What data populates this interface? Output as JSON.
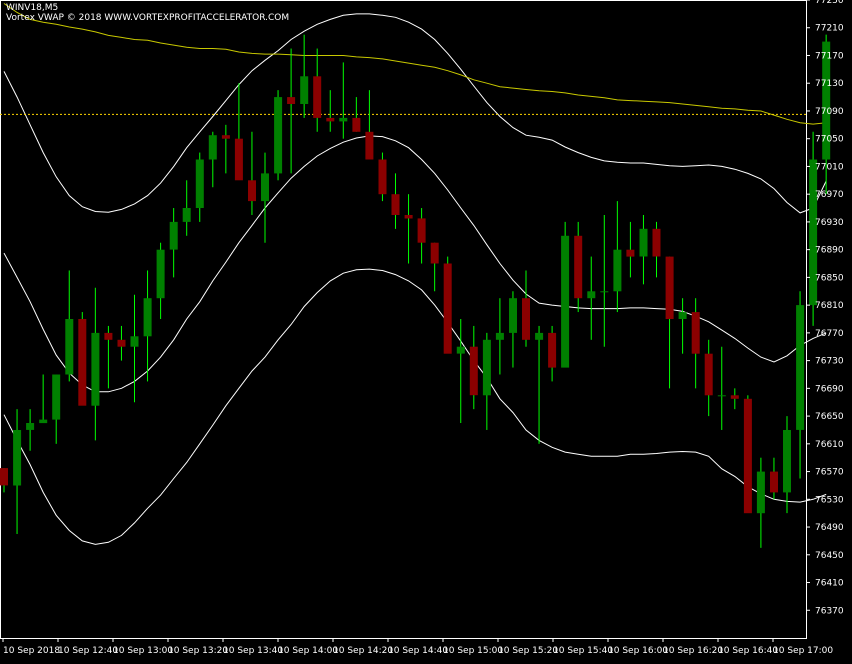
{
  "header": {
    "symbol": "WINV18,M5",
    "indicator": "Vortex VWAP © 2018 WWW.VORTEXPROFITACCELERATOR.COM"
  },
  "colors": {
    "background": "#000000",
    "grid": "#ffffff",
    "bull": "#008000",
    "bear": "#8b0000",
    "wick": "#00ff00",
    "vwap": "#c8c800",
    "bands": "#ffffff",
    "hline": "#ffd700"
  },
  "chart_data": {
    "type": "candlestick",
    "title": "WINV18,M5",
    "ylim": [
      76330,
      77250
    ],
    "y_ticks": [
      "77250",
      "77210",
      "77170",
      "77130",
      "77090",
      "77050",
      "77010",
      "76970",
      "76930",
      "76890",
      "76850",
      "76810",
      "76770",
      "76730",
      "76690",
      "76650",
      "76610",
      "76570",
      "76530",
      "76490",
      "76450",
      "76410",
      "76370"
    ],
    "x_ticks": [
      "10 Sep 2018",
      "10 Sep 12:40",
      "10 Sep 13:00",
      "10 Sep 13:20",
      "10 Sep 13:40",
      "10 Sep 14:00",
      "10 Sep 14:20",
      "10 Sep 14:40",
      "10 Sep 15:00",
      "10 Sep 15:20",
      "10 Sep 15:40",
      "10 Sep 16:00",
      "10 Sep 16:20",
      "10 Sep 16:40",
      "10 Sep 17:00"
    ],
    "horizontal_line": 77085,
    "candles": [
      {
        "o": 76575,
        "h": 76575,
        "l": 76540,
        "c": 76550
      },
      {
        "o": 76550,
        "h": 76660,
        "l": 76480,
        "c": 76630
      },
      {
        "o": 76630,
        "h": 76660,
        "l": 76600,
        "c": 76640
      },
      {
        "o": 76640,
        "h": 76710,
        "l": 76640,
        "c": 76645
      },
      {
        "o": 76645,
        "h": 76710,
        "l": 76610,
        "c": 76710
      },
      {
        "o": 76710,
        "h": 76860,
        "l": 76700,
        "c": 76790
      },
      {
        "o": 76790,
        "h": 76800,
        "l": 76680,
        "c": 76665
      },
      {
        "o": 76665,
        "h": 76835,
        "l": 76615,
        "c": 76770
      },
      {
        "o": 76770,
        "h": 76780,
        "l": 76690,
        "c": 76760
      },
      {
        "o": 76760,
        "h": 76780,
        "l": 76730,
        "c": 76750
      },
      {
        "o": 76750,
        "h": 76825,
        "l": 76670,
        "c": 76765
      },
      {
        "o": 76765,
        "h": 76860,
        "l": 76700,
        "c": 76820
      },
      {
        "o": 76820,
        "h": 76900,
        "l": 76790,
        "c": 76890
      },
      {
        "o": 76890,
        "h": 76950,
        "l": 76850,
        "c": 76930
      },
      {
        "o": 76930,
        "h": 76990,
        "l": 76910,
        "c": 76950
      },
      {
        "o": 76950,
        "h": 77030,
        "l": 76930,
        "c": 77020
      },
      {
        "o": 77020,
        "h": 77060,
        "l": 76980,
        "c": 77055
      },
      {
        "o": 77055,
        "h": 77070,
        "l": 77000,
        "c": 77050
      },
      {
        "o": 77050,
        "h": 77130,
        "l": 77020,
        "c": 76990
      },
      {
        "o": 76990,
        "h": 77060,
        "l": 76940,
        "c": 76960
      },
      {
        "o": 76960,
        "h": 77030,
        "l": 76900,
        "c": 77000
      },
      {
        "o": 77000,
        "h": 77120,
        "l": 76990,
        "c": 77110
      },
      {
        "o": 77110,
        "h": 77180,
        "l": 77000,
        "c": 77100
      },
      {
        "o": 77100,
        "h": 77200,
        "l": 77080,
        "c": 77140
      },
      {
        "o": 77140,
        "h": 77180,
        "l": 77060,
        "c": 77080
      },
      {
        "o": 77080,
        "h": 77120,
        "l": 77060,
        "c": 77075
      },
      {
        "o": 77075,
        "h": 77160,
        "l": 77050,
        "c": 77080
      },
      {
        "o": 77080,
        "h": 77110,
        "l": 77060,
        "c": 77060
      },
      {
        "o": 77060,
        "h": 77120,
        "l": 77020,
        "c": 77020
      },
      {
        "o": 77020,
        "h": 77030,
        "l": 76960,
        "c": 76970
      },
      {
        "o": 76970,
        "h": 77000,
        "l": 76920,
        "c": 76940
      },
      {
        "o": 76940,
        "h": 76970,
        "l": 76870,
        "c": 76935
      },
      {
        "o": 76935,
        "h": 76950,
        "l": 76870,
        "c": 76900
      },
      {
        "o": 76900,
        "h": 76900,
        "l": 76830,
        "c": 76870
      },
      {
        "o": 76870,
        "h": 76880,
        "l": 76780,
        "c": 76740
      },
      {
        "o": 76740,
        "h": 76790,
        "l": 76640,
        "c": 76750
      },
      {
        "o": 76750,
        "h": 76780,
        "l": 76660,
        "c": 76680
      },
      {
        "o": 76680,
        "h": 76770,
        "l": 76630,
        "c": 76760
      },
      {
        "o": 76760,
        "h": 76820,
        "l": 76710,
        "c": 76770
      },
      {
        "o": 76770,
        "h": 76830,
        "l": 76720,
        "c": 76820
      },
      {
        "o": 76820,
        "h": 76860,
        "l": 76750,
        "c": 76760
      },
      {
        "o": 76760,
        "h": 76780,
        "l": 76610,
        "c": 76770
      },
      {
        "o": 76770,
        "h": 76780,
        "l": 76700,
        "c": 76720
      },
      {
        "o": 76720,
        "h": 76930,
        "l": 76720,
        "c": 76910
      },
      {
        "o": 76910,
        "h": 76930,
        "l": 76800,
        "c": 76820
      },
      {
        "o": 76820,
        "h": 76880,
        "l": 76760,
        "c": 76830
      },
      {
        "o": 76830,
        "h": 76940,
        "l": 76750,
        "c": 76830
      },
      {
        "o": 76830,
        "h": 76960,
        "l": 76800,
        "c": 76890
      },
      {
        "o": 76890,
        "h": 76930,
        "l": 76850,
        "c": 76880
      },
      {
        "o": 76880,
        "h": 76940,
        "l": 76840,
        "c": 76920
      },
      {
        "o": 76920,
        "h": 76930,
        "l": 76850,
        "c": 76880
      },
      {
        "o": 76880,
        "h": 76880,
        "l": 76690,
        "c": 76790
      },
      {
        "o": 76790,
        "h": 76820,
        "l": 76740,
        "c": 76800
      },
      {
        "o": 76800,
        "h": 76820,
        "l": 76690,
        "c": 76740
      },
      {
        "o": 76740,
        "h": 76760,
        "l": 76650,
        "c": 76680
      },
      {
        "o": 76680,
        "h": 76750,
        "l": 76630,
        "c": 76680
      },
      {
        "o": 76680,
        "h": 76690,
        "l": 76660,
        "c": 76675
      },
      {
        "o": 76675,
        "h": 76680,
        "l": 76520,
        "c": 76510
      },
      {
        "o": 76510,
        "h": 76590,
        "l": 76460,
        "c": 76570
      },
      {
        "o": 76570,
        "h": 76590,
        "l": 76530,
        "c": 76540
      },
      {
        "o": 76540,
        "h": 76650,
        "l": 76510,
        "c": 76630
      },
      {
        "o": 76630,
        "h": 76830,
        "l": 76560,
        "c": 76810
      },
      {
        "o": 76810,
        "h": 77060,
        "l": 76780,
        "c": 77020
      },
      {
        "o": 77020,
        "h": 77200,
        "l": 76970,
        "c": 77190
      }
    ],
    "vwap": [
      77245,
      77232,
      77222,
      77218,
      77215,
      77211,
      77208,
      77204,
      77199,
      77196,
      77193,
      77192,
      77188,
      77185,
      77182,
      77180,
      77180,
      77179,
      77175,
      77173,
      77172,
      77172,
      77171,
      77170,
      77170,
      77170,
      77170,
      77168,
      77167,
      77165,
      77162,
      77159,
      77156,
      77153,
      77148,
      77142,
      77135,
      77130,
      77125,
      77123,
      77121,
      77119,
      77118,
      77116,
      77113,
      77111,
      77109,
      77106,
      77105,
      77104,
      77103,
      77102,
      77100,
      77098,
      77096,
      77094,
      77093,
      77091,
      77090,
      77084,
      77078,
      77073,
      77071,
      77073
    ],
    "upper_band": [
      77147,
      77110,
      77070,
      77030,
      76995,
      76968,
      76952,
      76945,
      76944,
      76948,
      76956,
      76968,
      76986,
      77010,
      77037,
      77060,
      77082,
      77105,
      77128,
      77148,
      77163,
      77177,
      77193,
      77205,
      77215,
      77222,
      77228,
      77230,
      77230,
      77228,
      77225,
      77218,
      77208,
      77193,
      77173,
      77150,
      77126,
      77102,
      77082,
      77066,
      77055,
      77052,
      77048,
      77038,
      77030,
      77023,
      77018,
      77016,
      77015,
      77015,
      77013,
      77011,
      77010,
      77011,
      77012,
      77010,
      77006,
      77000,
      76992,
      76978,
      76958,
      76943,
      76950,
      76989
    ],
    "middle_band": [
      76885,
      76850,
      76815,
      76775,
      76738,
      76712,
      76695,
      76685,
      76685,
      76690,
      76700,
      76715,
      76735,
      76760,
      76790,
      76815,
      76845,
      76872,
      76900,
      76925,
      76950,
      76972,
      76993,
      77010,
      77025,
      77036,
      77045,
      77051,
      77054,
      77053,
      77047,
      77037,
      77020,
      77000,
      76976,
      76950,
      76925,
      76897,
      76870,
      76846,
      76826,
      76813,
      76810,
      76808,
      76806,
      76805,
      76805,
      76805,
      76806,
      76806,
      76805,
      76804,
      76801,
      76794,
      76786,
      76774,
      76762,
      76748,
      76735,
      76728,
      76737,
      76752,
      76762,
      76770
    ],
    "lower_band": [
      76652,
      76615,
      76580,
      76540,
      76507,
      76485,
      76470,
      76465,
      76468,
      76478,
      76496,
      76517,
      76536,
      76560,
      76583,
      76610,
      76637,
      76665,
      76690,
      76715,
      76735,
      76760,
      76782,
      76808,
      76828,
      76845,
      76856,
      76861,
      76862,
      76860,
      76854,
      76845,
      76832,
      76810,
      76785,
      76758,
      76730,
      76705,
      76675,
      76655,
      76630,
      76615,
      76605,
      76598,
      76595,
      76592,
      76592,
      76592,
      76595,
      76595,
      76596,
      76598,
      76599,
      76598,
      76592,
      76574,
      76563,
      76548,
      76538,
      76530,
      76527,
      76526,
      76530,
      76537
    ]
  }
}
